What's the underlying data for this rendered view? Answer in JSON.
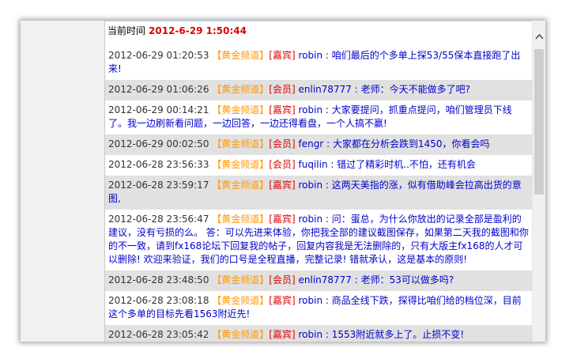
{
  "header": {
    "label": "当前时间",
    "time": "2012-6-29 1:50:44"
  },
  "messages": [
    {
      "ts": "2012-06-29 01:20:53",
      "channel": "【黄金频道】",
      "role": "[嘉宾]",
      "user": "robin",
      "sep": ":",
      "text": "咱们最后的个多单上探53/55保本直接跑了出来!"
    },
    {
      "ts": "2012-06-29 01:06:26",
      "channel": "【黄金频道】",
      "role": "[会员]",
      "user": "enlin78777",
      "sep": ":",
      "text": "老师：今天不能做多了吧?"
    },
    {
      "ts": "2012-06-29 00:14:21",
      "channel": "【黄金频道】",
      "role": "[嘉宾]",
      "user": "robin",
      "sep": ":",
      "text": "大家要提问，抓重点提问，咱们管理员下线了。我一边刷新看问题，一边回答，一边还得看盘，一个人搞不赢!"
    },
    {
      "ts": "2012-06-29 00:02:50",
      "channel": "【黄金频道】",
      "role": "[会员]",
      "user": "fengr",
      "sep": ":",
      "text": "大家都在分析会跌到1450，你看会吗"
    },
    {
      "ts": "2012-06-28 23:56:33",
      "channel": "【黄金频道】",
      "role": "[会员]",
      "user": "fuqilin",
      "sep": ":",
      "text": "错过了精彩时机..不怕，还有机会"
    },
    {
      "ts": "2012-06-28 23:59:17",
      "channel": "【黄金频道】",
      "role": "[嘉宾]",
      "user": "robin",
      "sep": ":",
      "text": "这两天美指的涨，似有借助峰会拉高出货的意图,"
    },
    {
      "ts": "2012-06-28 23:56:47",
      "channel": "【黄金频道】",
      "role": "[嘉宾]",
      "user": "robin",
      "sep": ":",
      "text": "问：蛋总，为什么你放出的记录全部是盈利的建议，没有亏损的么。 答：可以先进来体验，你把我全部的建议截图保存，如果第二天我的截图和你的不一致，请到fx168论坛下回复我的帖子，回复内容我是无法删除的，只有大版主fx168的人才可以删除! 欢迎来验证，我们的口号是全程直播，完整记录! 错就承认，这是基本的原则!"
    },
    {
      "ts": "2012-06-28 23:48:50",
      "channel": "【黄金频道】",
      "role": "[会员]",
      "user": "enlin78777",
      "sep": ":",
      "text": "老师：53可以做多吗?"
    },
    {
      "ts": "2012-06-28 23:08:18",
      "channel": "【黄金频道】",
      "role": "[嘉宾]",
      "user": "robin",
      "sep": ":",
      "text": "商品全线下跌，探得比咱们给的档位深，目前这个多单的目标先看1563附近先!"
    },
    {
      "ts": "2012-06-28 23:05:42",
      "channel": "【黄金频道】",
      "role": "[嘉宾]",
      "user": "robin",
      "sep": ":",
      "text": "1553附近就多上了。止损不变!"
    }
  ],
  "colors": {
    "timestamp": "#333333",
    "channel": "#ff9900",
    "role": "#e00000",
    "text": "#0000cc",
    "alt_row": "#e1e1e1"
  },
  "scrollbar": {
    "up_icon": "chevron-up-icon"
  }
}
